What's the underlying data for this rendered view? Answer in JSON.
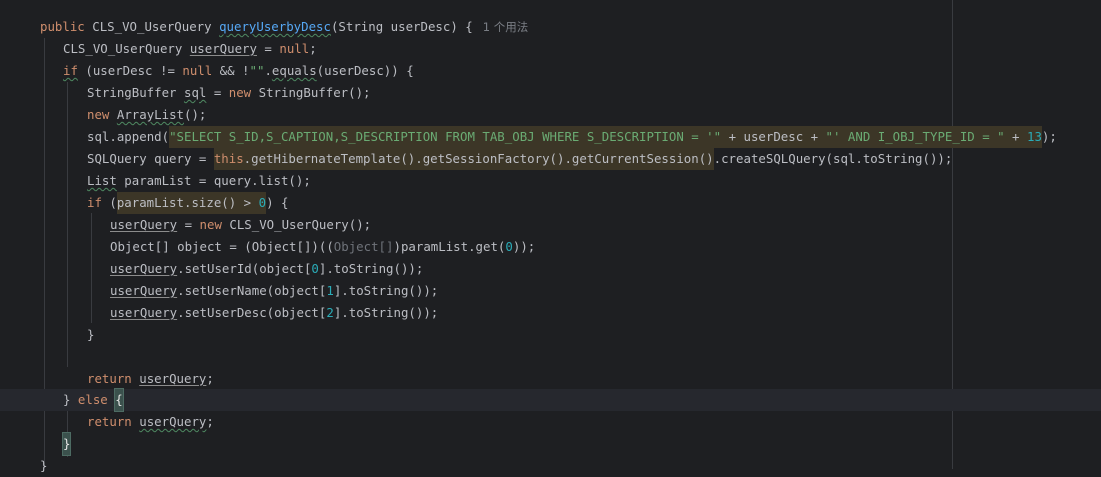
{
  "usage_hint": "1 个用法",
  "code": {
    "l1": [
      "public",
      "CLS_VO_UserQuery",
      "queryUserbyDesc",
      "(String userDesc) {"
    ],
    "l2": [
      "CLS_VO_UserQuery ",
      "userQuery",
      " = ",
      "null",
      ";"
    ],
    "l3": [
      "if",
      " (userDesc != ",
      "null",
      " && !",
      "\"\"",
      ".",
      "equals",
      "(userDesc)) {"
    ],
    "l4": [
      "StringBuffer ",
      "sql",
      " = ",
      "new",
      " StringBuffer();"
    ],
    "l5": [
      "new",
      " ",
      "ArrayList",
      "();"
    ],
    "l6": [
      "sql",
      ".append(",
      "\"SELECT S_ID,S_CAPTION,S_DESCRIPTION FROM TAB_OBJ WHERE S_DESCRIPTION = '\"",
      " + userDesc + ",
      "\"' AND I_OBJ_TYPE_ID = \"",
      " + ",
      "13",
      ");"
    ],
    "l7": [
      "SQLQuery query = ",
      "this",
      ".getHibernateTemplate().getSessionFactory().getCurrentSession()",
      ".createSQLQuery(sql.toString());"
    ],
    "l8": [
      "List",
      " paramList = query.list();"
    ],
    "l9": [
      "if",
      " (",
      "paramList.size() > ",
      "0",
      ") {"
    ],
    "l10": [
      "userQuery",
      " = ",
      "new",
      " CLS_VO_UserQuery();"
    ],
    "l11": [
      "Object[] object = (Object[])((",
      "Object[]",
      ")paramList.get(",
      "0",
      "));"
    ],
    "l12": [
      "userQuery",
      ".setUserId(object[",
      "0",
      "].toString());"
    ],
    "l13": [
      "userQuery",
      ".setUserName(object[",
      "1",
      "].toString());"
    ],
    "l14": [
      "userQuery",
      ".setUserDesc(object[",
      "2",
      "].toString());"
    ],
    "l15": [
      "}"
    ],
    "l17": [
      "return",
      " ",
      "userQuery",
      ";"
    ],
    "l18": [
      "} ",
      "else",
      " ",
      "{"
    ],
    "l19": [
      "return",
      " ",
      "userQuery",
      ";"
    ],
    "l20": [
      "}"
    ],
    "l21": [
      "}"
    ]
  },
  "colors": {
    "background": "#1e1f22",
    "keyword": "#cf8e6d",
    "function_declaration": "#56a8f5",
    "string": "#6aab73",
    "number": "#2aacb8",
    "default_text": "#bcbec4",
    "caret_row": "#26282e"
  }
}
